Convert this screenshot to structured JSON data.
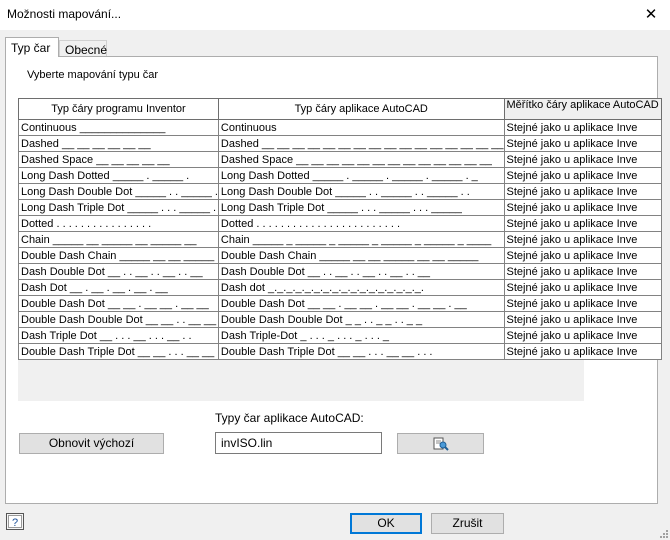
{
  "window": {
    "title": "Možnosti mapování...",
    "close_glyph": "✕"
  },
  "tabs": [
    {
      "label": "Typ čar"
    },
    {
      "label": "Obecné"
    }
  ],
  "instruction": "Vyberte mapování typu čar",
  "grid": {
    "headers": [
      "Typ čáry programu Inventor",
      "Typ čáry aplikace AutoCAD",
      "Měřítko čáry aplikace AutoCAD"
    ],
    "rows": [
      [
        "Continuous  ______________",
        "Continuous",
        "Stejné jako u aplikace Inve"
      ],
      [
        "Dashed  __ __ __ __ __ __",
        "Dashed __ __ __ __ __ __ __ __ __ __ __ __ __ __ __ __",
        "Stejné jako u aplikace Inve"
      ],
      [
        "Dashed Space  __   __   __   __   __",
        "Dashed Space __ __ __ __ __ __ __ __ __ __ __ __ __",
        "Stejné jako u aplikace Inve"
      ],
      [
        "Long Dash Dotted  _____ . _____ .",
        "Long Dash Dotted _____ . _____ . _____ . _____ . _",
        "Stejné jako u aplikace Inve"
      ],
      [
        "Long Dash Double  Dot  _____ . . _____ .",
        "Long Dash Double Dot _____ . . _____ . . _____ . .",
        "Stejné jako u aplikace Inve"
      ],
      [
        "Long Dash Triple Dot  _____ . . . _____ .",
        "Long Dash Triple Dot _____ . . . _____ . . . _____",
        "Stejné jako u aplikace Inve"
      ],
      [
        "Dotted  . . . . . . . . . . . . . . . .",
        "Dotted . . . . . . . . . . . . . . . . . . . . . . . .",
        "Stejné jako u aplikace Inve"
      ],
      [
        "Chain  _____ __ _____ __ _____ __",
        "Chain _____ _ _____ _ _____ _ _____ _ _____ _ ____",
        "Stejné jako u aplikace Inve"
      ],
      [
        "Double Dash Chain  _____ __ __ _____",
        "Double Dash Chain _____ __ __ _____ __ __ _____",
        "Stejné jako u aplikace Inve"
      ],
      [
        "Dash Double Dot  __ . . __ . . __ . . __",
        "Dash Double Dot __ . . __ . . __ . . __ . . __",
        "Stejné jako u aplikace Inve"
      ],
      [
        "Dash Dot  __ . __ . __ . __ . __",
        "Dash dot _._._._._._._._._._._._._._._._._.",
        "Stejné jako u aplikace Inve"
      ],
      [
        "Double Dash Dot  __ __ . __ __ . __ __",
        "Double Dash Dot __ __ . __ __ . __ __ . __ __ . __",
        "Stejné jako u aplikace Inve"
      ],
      [
        "Double Dash Double Dot  __ __ . . __ __",
        "Double Dash Double Dot _ _ . . _ _ . . _ _",
        "Stejné jako u aplikace Inve"
      ],
      [
        "Dash Triple Dot  __ . . . __ . . . __ . .",
        "Dash Triple-Dot _ . . . _ . . . _ . . . _",
        "Stejné jako u aplikace Inve"
      ],
      [
        "Double Dash Triple Dot  __ __ . . . __ __",
        "Double Dash Triple Dot __ __ . . . __ __ . . .",
        "Stejné jako u aplikace Inve"
      ]
    ]
  },
  "autocad_linetypes": {
    "label": "Typy čar aplikace AutoCAD:",
    "value": "invISO.lin"
  },
  "buttons": {
    "reset": "Obnovit výchozí",
    "ok": "OK",
    "cancel": "Zrušit"
  },
  "icons": {
    "browse": "open-file-icon",
    "help": "help-icon"
  }
}
